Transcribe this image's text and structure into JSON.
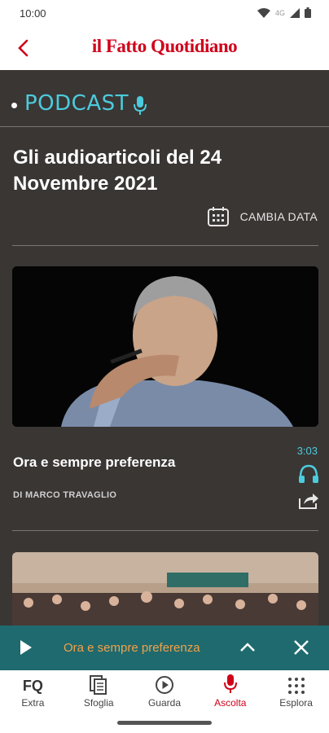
{
  "status_bar": {
    "time": "10:00",
    "network": "4G"
  },
  "header": {
    "back_icon": "chevron-left-icon",
    "logo_text": "il Fatto Quotidiano"
  },
  "section": {
    "label": "PODCAST",
    "icon": "microphone-icon"
  },
  "page": {
    "title": "Gli audioarticoli del 24 Novembre 2021"
  },
  "date_picker": {
    "label": "CAMBIA DATA",
    "icon": "calendar-icon"
  },
  "articles": [
    {
      "title": "Ora e sempre preferenza",
      "author": "DI MARCO TRAVAGLIO",
      "duration": "3:03",
      "listen_icon": "headphones-icon",
      "share_icon": "share-icon"
    }
  ],
  "player": {
    "title": "Ora e sempre preferenza",
    "play_icon": "play-icon",
    "expand_icon": "chevron-up-icon",
    "close_icon": "close-icon"
  },
  "tabs": [
    {
      "label": "Extra",
      "icon_text": "FQ",
      "icon": "fq-icon",
      "active": false
    },
    {
      "label": "Sfoglia",
      "icon": "pages-icon",
      "active": false
    },
    {
      "label": "Guarda",
      "icon": "play-circle-icon",
      "active": false
    },
    {
      "label": "Ascolta",
      "icon": "microphone-icon",
      "active": true
    },
    {
      "label": "Esplora",
      "icon": "grid-dots-icon",
      "active": false
    }
  ],
  "colors": {
    "brand_red": "#d0021b",
    "accent_cyan": "#4ccbdc",
    "content_bg": "#3a3634",
    "player_bg": "#1f6a6e",
    "player_text": "#f2a14a"
  }
}
